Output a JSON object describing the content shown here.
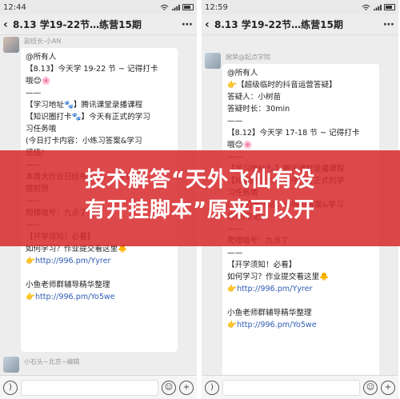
{
  "left": {
    "status": {
      "time": "12:44",
      "battery": ""
    },
    "title": "8.13 学19-22节…练营15期",
    "message": {
      "sender": "副班长-小AN",
      "lines": [
        "@所有人",
        "【8.13】今天学 19-22 节 ~ 记得打卡",
        "哦😊🌸",
        "——",
        "【学习地址🐾】腾讯课堂录播课程",
        "【知识圈打卡🐾】今天有正式的学习",
        "习任务哦",
        "(今日打卡内容：小练习答案&学习",
        "感悟/",
        "——",
        "本周大作业已经布置啦，上交记得",
        "提前预",
        "——",
        "爬楼暗号：九点了",
        "——",
        "【开学须知！必看】",
        "如何学习？作业提交看这里🐥",
        "👉http://996.pm/Yyrer",
        "",
        "小鱼老师群辅导精华整理",
        "👉http://996.pm/Yo5we"
      ],
      "next_sender": "小石头~北京~编辑"
    }
  },
  "right": {
    "status": {
      "time": "12:59",
      "battery": ""
    },
    "title": "8.13 学19-22节…练营15期",
    "message": {
      "sender": "婉荣@起点学院",
      "lines": [
        "@所有人",
        "👉【超级临时的抖音运营答疑】",
        "答疑人：小树苗",
        "答疑时长：30min",
        "——",
        "【8.12】今天学 17-18 节 ~ 记得打卡",
        "哦😊🌸",
        "——",
        "【学习地址🐾】腾讯课堂录播课程",
        "【知识圈打卡🐾】今天有正式的学",
        "习任务哦",
        "(今日打卡内容：小练习答案&学习",
        "感悟/笔记)",
        "——",
        "爬楼暗号：九点了",
        "——",
        "【开学须知！必看】",
        "如何学习？作业提交看这里🐥",
        "👉http://996.pm/Yyrer",
        "",
        "小鱼老师群辅导精华整理",
        "👉http://996.pm/Yo5we"
      ]
    }
  },
  "headline": {
    "line1": "技术解答“天外飞仙有没",
    "line2": "有开挂脚本”原来可以开"
  }
}
